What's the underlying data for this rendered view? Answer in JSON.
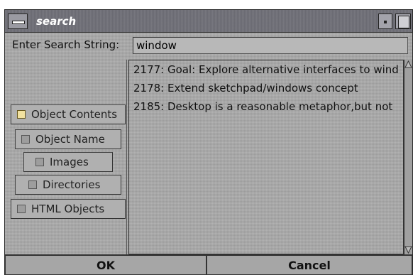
{
  "window": {
    "title": "search"
  },
  "search": {
    "label": "Enter Search String:",
    "value": "window"
  },
  "options": [
    {
      "label": "Object Contents",
      "checked": true
    },
    {
      "label": "Object Name",
      "checked": false
    },
    {
      "label": "Images",
      "checked": false
    },
    {
      "label": "Directories",
      "checked": false
    },
    {
      "label": "HTML Objects",
      "checked": false
    }
  ],
  "results": [
    "2177: Goal: Explore alternative interfaces to wind",
    "2178: Extend sketchpad/windows concept",
    "2185: Desktop is a reasonable metaphor,but not"
  ],
  "buttons": {
    "ok": "OK",
    "cancel": "Cancel"
  },
  "colors": {
    "titlebar": "#6b6b73",
    "body": "#a9a9a9",
    "checked": "#f2e2a0"
  }
}
